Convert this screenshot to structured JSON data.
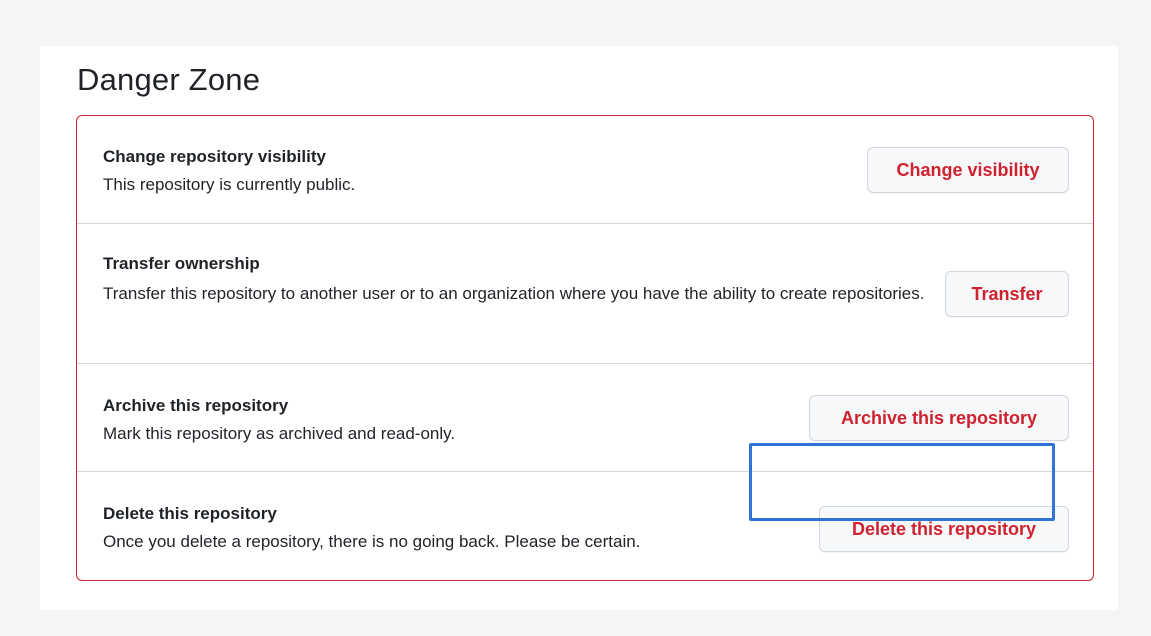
{
  "section": {
    "title": "Danger Zone"
  },
  "rows": [
    {
      "title": "Change repository visibility",
      "description": "This repository is currently public.",
      "button_label": "Change visibility"
    },
    {
      "title": "Transfer ownership",
      "description": "Transfer this repository to another user or to an organization where you have the ability to create repositories.",
      "button_label": "Transfer"
    },
    {
      "title": "Archive this repository",
      "description": "Mark this repository as archived and read-only.",
      "button_label": "Archive this repository"
    },
    {
      "title": "Delete this repository",
      "description": "Once you delete a repository, there is no going back. Please be certain.",
      "button_label": "Delete this repository"
    }
  ],
  "colors": {
    "danger": "#cf222e",
    "highlight": "#2f74d4",
    "text": "#1f2328",
    "divider": "#d0d7de",
    "button_bg": "#f6f8fa"
  }
}
